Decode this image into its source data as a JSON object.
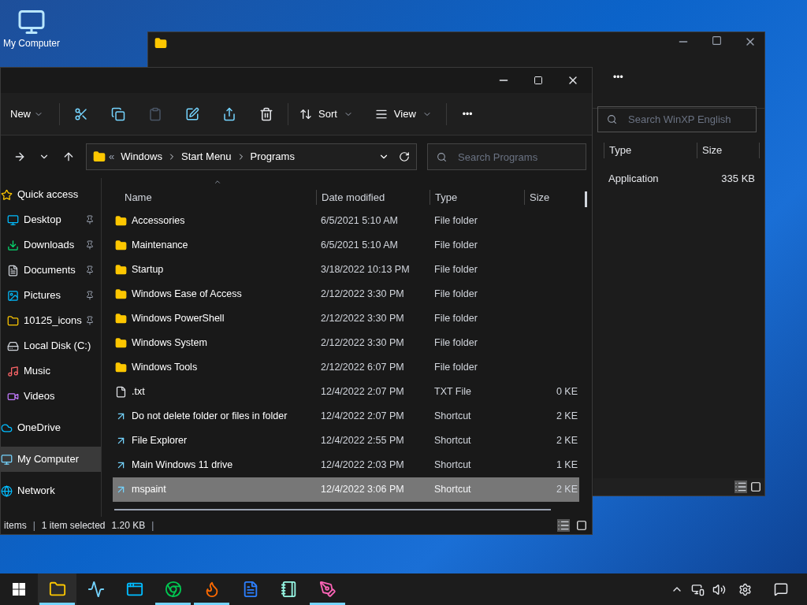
{
  "desktop_icons": [
    {
      "label": "My Computer"
    }
  ],
  "back_window": {
    "search": {
      "placeholder": "Search WinXP English"
    },
    "more": "•••",
    "columns": [
      "Type",
      "Size"
    ],
    "rows": [
      {
        "type": "Application",
        "size": "335 KB"
      }
    ]
  },
  "window": {
    "toolbar": {
      "new": "New",
      "sort": "Sort",
      "view": "View",
      "more": "•••"
    },
    "address": {
      "prefix": "«",
      "crumbs": [
        "Windows",
        "Start Menu",
        "Programs"
      ]
    },
    "search": {
      "placeholder": "Search Programs"
    },
    "nav": [
      {
        "label": "Quick access",
        "kind": "star",
        "selected": false,
        "children": [
          {
            "label": "Desktop",
            "kind": "desktop",
            "pinned": true,
            "selected": false
          },
          {
            "label": "Downloads",
            "kind": "download",
            "pinned": true,
            "selected": false
          },
          {
            "label": "Documents",
            "kind": "document",
            "pinned": true,
            "selected": false
          },
          {
            "label": "Pictures",
            "kind": "picture",
            "pinned": true,
            "selected": false
          },
          {
            "label": "10125_icons",
            "kind": "folder",
            "pinned": true,
            "selected": false
          },
          {
            "label": "Local Disk (C:)",
            "kind": "disk",
            "pinned": false,
            "selected": false
          },
          {
            "label": "Music",
            "kind": "music",
            "pinned": false,
            "selected": false
          },
          {
            "label": "Videos",
            "kind": "video",
            "pinned": false,
            "selected": false
          }
        ]
      },
      {
        "label": "OneDrive",
        "kind": "cloud",
        "selected": false
      },
      {
        "label": "My Computer",
        "kind": "computer",
        "selected": true
      },
      {
        "label": "Network",
        "kind": "network",
        "selected": false
      }
    ],
    "columns": [
      "Name",
      "Date modified",
      "Type",
      "Size"
    ],
    "rows": [
      {
        "name": "Accessories",
        "date": "6/5/2021 5:10 AM",
        "type": "File folder",
        "kind": "folder",
        "selected": false
      },
      {
        "name": "Maintenance",
        "date": "6/5/2021 5:10 AM",
        "type": "File folder",
        "kind": "folder",
        "selected": false
      },
      {
        "name": "Startup",
        "date": "3/18/2022 10:13 PM",
        "type": "File folder",
        "kind": "folder",
        "selected": false
      },
      {
        "name": "Windows Ease of Access",
        "date": "2/12/2022 3:30 PM",
        "type": "File folder",
        "kind": "folder",
        "selected": false
      },
      {
        "name": "Windows PowerShell",
        "date": "2/12/2022 3:30 PM",
        "type": "File folder",
        "kind": "folder",
        "selected": false
      },
      {
        "name": "Windows System",
        "date": "2/12/2022 3:30 PM",
        "type": "File folder",
        "kind": "folder",
        "selected": false
      },
      {
        "name": "Windows Tools",
        "date": "2/12/2022 6:07 PM",
        "type": "File folder",
        "kind": "folder",
        "selected": false
      },
      {
        "name": ".txt",
        "date": "12/4/2022 2:07 PM",
        "type": "TXT File",
        "size": "0 KE",
        "kind": "file",
        "selected": false
      },
      {
        "name": "Do not delete folder or files in folder",
        "date": "12/4/2022 2:07 PM",
        "type": "Shortcut",
        "size": "2 KE",
        "kind": "shortcut",
        "selected": false
      },
      {
        "name": "File Explorer",
        "date": "12/4/2022 2:55 PM",
        "type": "Shortcut",
        "size": "2 KE",
        "kind": "shortcut",
        "selected": false
      },
      {
        "name": "Main Windows 11 drive",
        "date": "12/4/2022 2:03 PM",
        "type": "Shortcut",
        "size": "1 KE",
        "kind": "shortcut",
        "selected": false
      },
      {
        "name": "mspaint",
        "date": "12/4/2022 3:06 PM",
        "type": "Shortcut",
        "size": "2 KE",
        "kind": "shortcut",
        "selected": true
      }
    ],
    "status": [
      {
        "kind": "text",
        "text": "items"
      },
      {
        "kind": "separator",
        "text": "|"
      },
      {
        "kind": "text",
        "text": "1 item selected"
      },
      {
        "kind": "text",
        "text": "1.20 KB"
      },
      {
        "kind": "separator",
        "text": "|"
      }
    ]
  },
  "taskbar": {
    "apps": [
      {
        "kind": "explorer",
        "active": true
      },
      {
        "kind": "monitor",
        "active": false
      },
      {
        "kind": "window",
        "active": false
      },
      {
        "kind": "chrome",
        "active": true
      },
      {
        "kind": "firefox",
        "active": true
      },
      {
        "kind": "doc",
        "active": false
      },
      {
        "kind": "notepad",
        "active": false
      },
      {
        "kind": "paint",
        "active": true
      }
    ]
  }
}
